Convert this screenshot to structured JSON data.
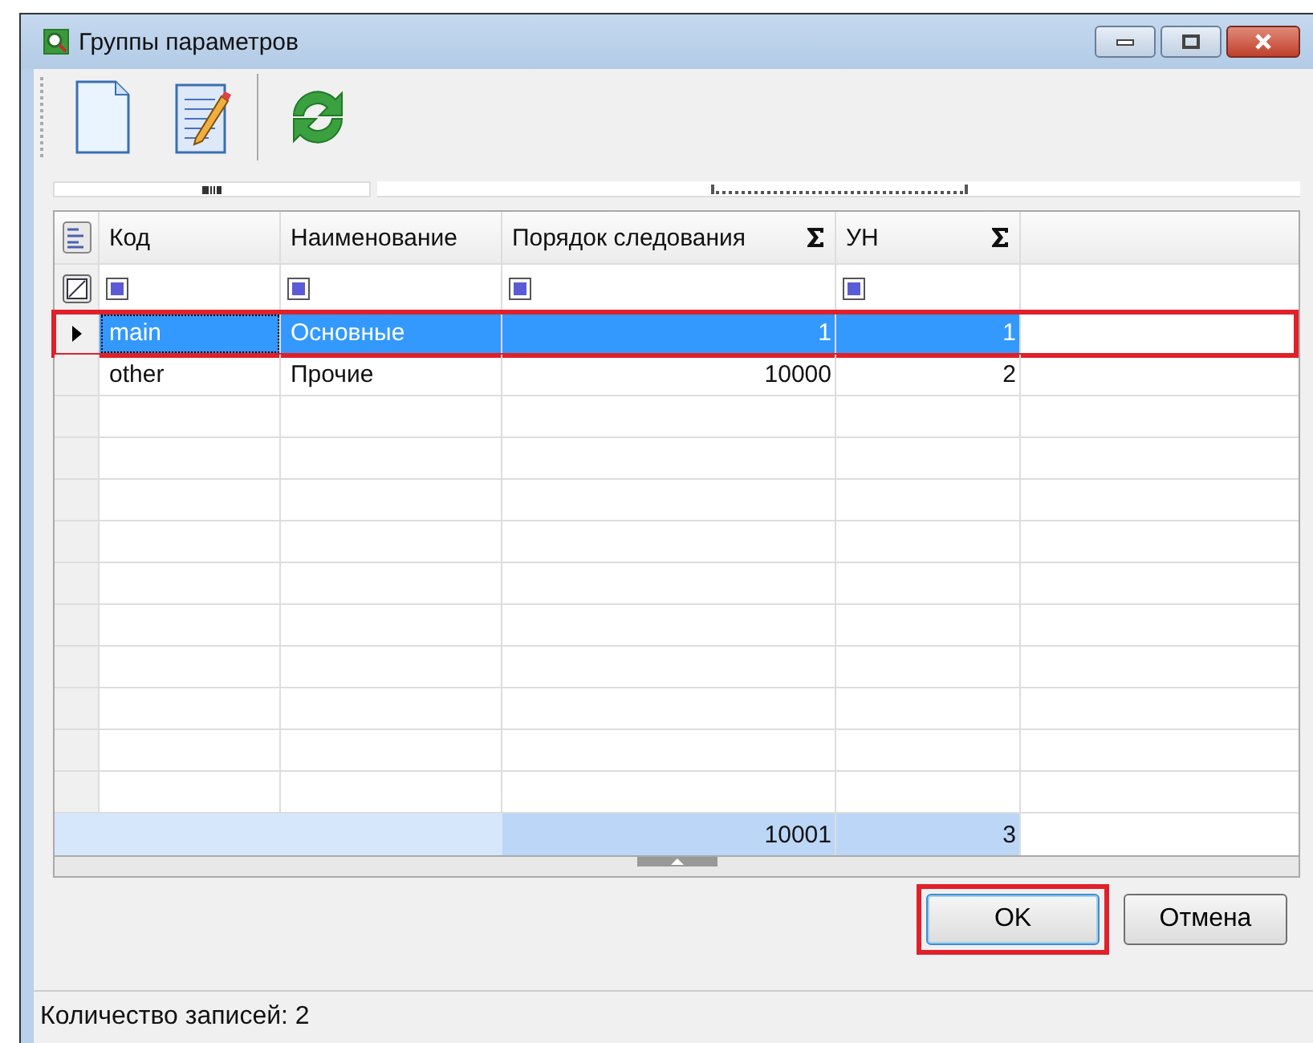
{
  "window": {
    "title": "Группы параметров"
  },
  "toolbar": {
    "buttons": [
      {
        "kind": "new"
      },
      {
        "kind": "edit"
      },
      {
        "kind": "refresh"
      }
    ]
  },
  "grid": {
    "columns": [
      {
        "label": "Код",
        "sum": false,
        "filter_partial": true
      },
      {
        "label": "Наименование",
        "sum": false,
        "filter_partial": true
      },
      {
        "label": "Порядок следования",
        "sum": true,
        "filter_partial": true
      },
      {
        "label": "УН",
        "sum": true,
        "filter_partial": true
      }
    ],
    "rows": [
      {
        "cells": [
          "main",
          "Основные",
          "1",
          "1"
        ],
        "selected": true,
        "highlighted": true
      },
      {
        "cells": [
          "other",
          "Прочие",
          "10000",
          "2"
        ],
        "selected": false,
        "highlighted": false
      }
    ],
    "totals": [
      "10001",
      "3"
    ]
  },
  "buttons": [
    {
      "label": "OK",
      "default": true,
      "highlighted": true
    },
    {
      "label": "Отмена",
      "default": false,
      "highlighted": false
    }
  ],
  "status_bar": "Количество записей: 2"
}
